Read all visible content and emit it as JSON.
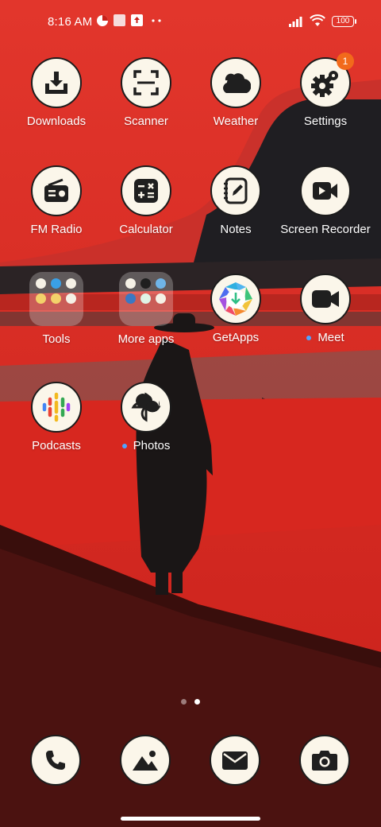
{
  "status_bar": {
    "time": "8:16 AM",
    "battery": "100"
  },
  "apps": [
    {
      "label": "Downloads",
      "icon": "download-icon"
    },
    {
      "label": "Scanner",
      "icon": "scanner-icon"
    },
    {
      "label": "Weather",
      "icon": "weather-cloud-icon"
    },
    {
      "label": "Settings",
      "icon": "gear-icon",
      "badge": "1"
    },
    {
      "label": "FM Radio",
      "icon": "radio-icon"
    },
    {
      "label": "Calculator",
      "icon": "calculator-icon"
    },
    {
      "label": "Notes",
      "icon": "notes-icon"
    },
    {
      "label": "Screen Recorder",
      "icon": "screen-recorder-icon"
    },
    {
      "label": "Tools",
      "icon": "folder-icon"
    },
    {
      "label": "More apps",
      "icon": "folder-icon"
    },
    {
      "label": "GetApps",
      "icon": "getapps-icon"
    },
    {
      "label": "Meet",
      "icon": "video-camera-icon",
      "new": true
    },
    {
      "label": "Podcasts",
      "icon": "podcasts-icon"
    },
    {
      "label": "Photos",
      "icon": "photos-icon",
      "new": true
    }
  ],
  "dock": [
    {
      "icon": "phone-icon"
    },
    {
      "icon": "gallery-icon"
    },
    {
      "icon": "mail-icon"
    },
    {
      "icon": "camera-icon"
    }
  ],
  "colors": {
    "accent_badge": "#f26a1b",
    "new_dot": "#4fa3ff",
    "icon_background": "#fbf6ea",
    "wallpaper_red": "#d8231d"
  }
}
